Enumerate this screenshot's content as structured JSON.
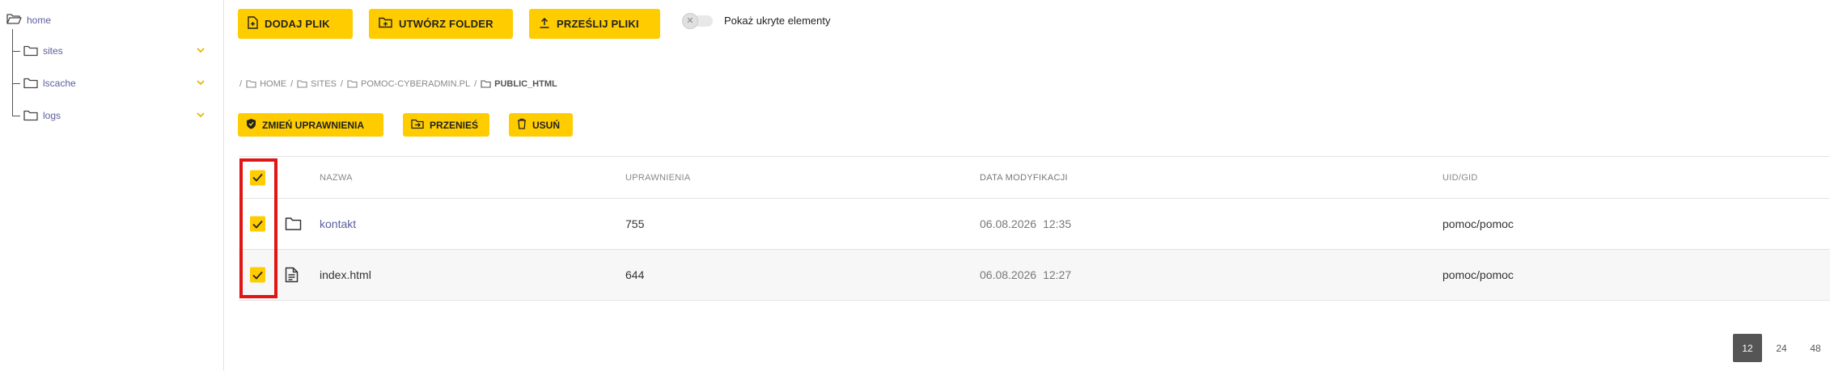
{
  "sidebar": {
    "root_label": "home",
    "items": [
      {
        "label": "sites"
      },
      {
        "label": "lscache"
      },
      {
        "label": "logs"
      }
    ]
  },
  "toolbar": {
    "add_file": "DODAJ PLIK",
    "create_folder": "UTWÓRZ FOLDER",
    "upload_files": "PRZEŚLIJ PLIKI",
    "show_hidden_label": "Pokaż ukryte elementy"
  },
  "breadcrumb": [
    {
      "label": "HOME"
    },
    {
      "label": "SITES"
    },
    {
      "label": "POMOC-CYBERADMIN.PL"
    },
    {
      "label": "PUBLIC_HTML"
    }
  ],
  "actions": {
    "change_permissions": "ZMIEŃ UPRAWNIENIA",
    "move": "PRZENIEŚ",
    "delete": "USUŃ"
  },
  "table": {
    "headers": {
      "name": "NAZWA",
      "permissions": "UPRAWNIENIA",
      "modified": "DATA MODYFIKACJI",
      "uid_gid": "UID/GID"
    },
    "rows": [
      {
        "name": "kontakt",
        "type": "folder",
        "permissions": "755",
        "date": "06.08.2026",
        "time": "12:35",
        "uid_gid": "pomoc/pomoc",
        "checked": true
      },
      {
        "name": "index.html",
        "type": "file",
        "permissions": "644",
        "date": "06.08.2026",
        "time": "12:27",
        "uid_gid": "pomoc/pomoc",
        "checked": true
      }
    ]
  },
  "pagination": {
    "sizes": [
      "12",
      "24",
      "48"
    ],
    "active": "12"
  },
  "colors": {
    "accent": "#ffcc00",
    "link": "#5a5f9e",
    "highlight": "#e01515"
  }
}
